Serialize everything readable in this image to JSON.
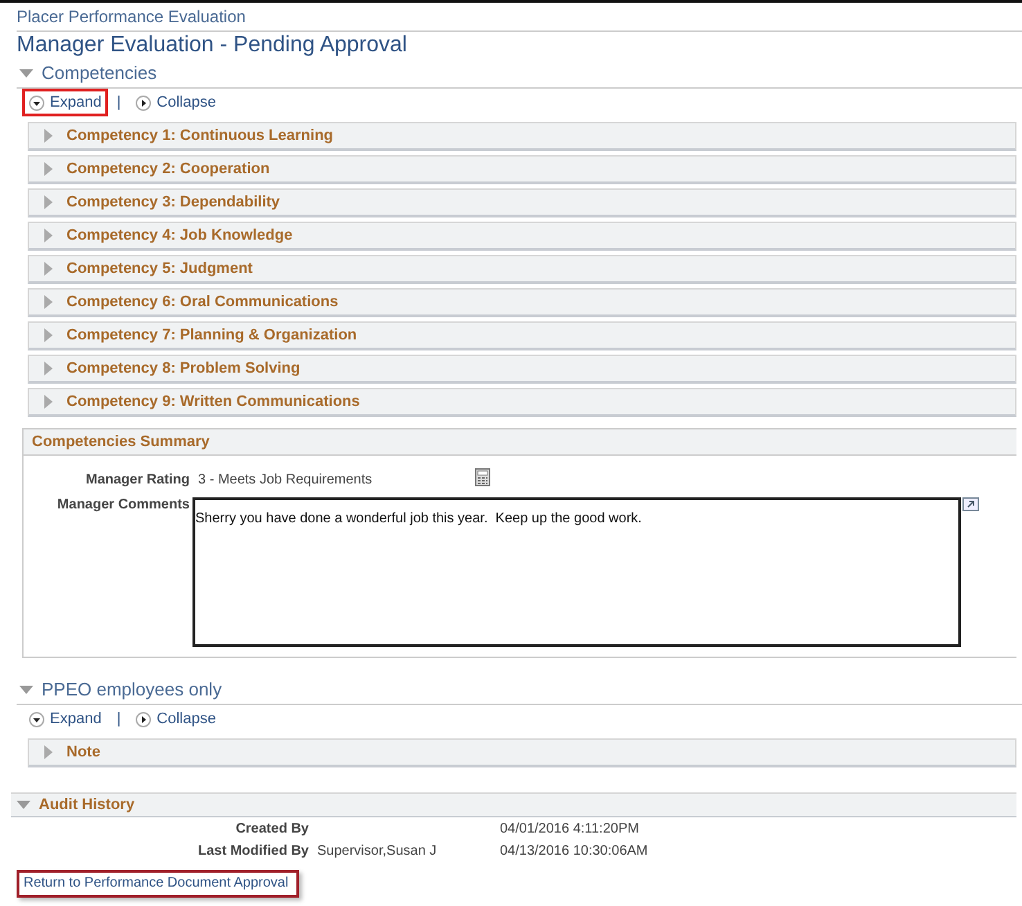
{
  "breadcrumb": "Placer Performance Evaluation",
  "page_title": "Manager Evaluation - Pending Approval",
  "competencies": {
    "title": "Competencies",
    "expanded": true,
    "expand": {
      "label": "Expand",
      "highlighted": true
    },
    "separator": "|",
    "collapse": {
      "label": "Collapse",
      "highlighted": false
    },
    "items": [
      {
        "label": "Competency 1: Continuous Learning",
        "expanded": false
      },
      {
        "label": "Competency 2: Cooperation",
        "expanded": false
      },
      {
        "label": "Competency 3: Dependability",
        "expanded": false
      },
      {
        "label": "Competency 4: Job Knowledge",
        "expanded": false
      },
      {
        "label": "Competency 5: Judgment",
        "expanded": false
      },
      {
        "label": "Competency 6: Oral Communications",
        "expanded": false
      },
      {
        "label": "Competency 7: Planning & Organization",
        "expanded": false
      },
      {
        "label": "Competency 8: Problem Solving",
        "expanded": false
      },
      {
        "label": "Competency 9: Written Communications",
        "expanded": false
      }
    ]
  },
  "summary": {
    "title": "Competencies Summary",
    "rating_label": "Manager Rating",
    "rating_value": "3 - Meets Job Requirements",
    "comments_label": "Manager Comments",
    "comments_value": "Sherry you have done a wonderful job this year.  Keep up the good work."
  },
  "ppeo": {
    "title": "PPEO employees only",
    "expanded": true,
    "expand": {
      "label": "Expand",
      "highlighted": false
    },
    "separator": "|",
    "collapse": {
      "label": "Collapse",
      "highlighted": false
    },
    "items": [
      {
        "label": "Note",
        "expanded": false
      }
    ]
  },
  "audit": {
    "title": "Audit History",
    "expanded": true,
    "rows": [
      {
        "label": "Created By",
        "user": "",
        "datetime": "04/01/2016  4:11:20PM"
      },
      {
        "label": "Last Modified By",
        "user": "Supervisor,Susan J",
        "datetime": "04/13/2016 10:30:06AM"
      }
    ]
  },
  "return_link": {
    "label": "Return to Performance Document Approval",
    "highlighted": true
  }
}
